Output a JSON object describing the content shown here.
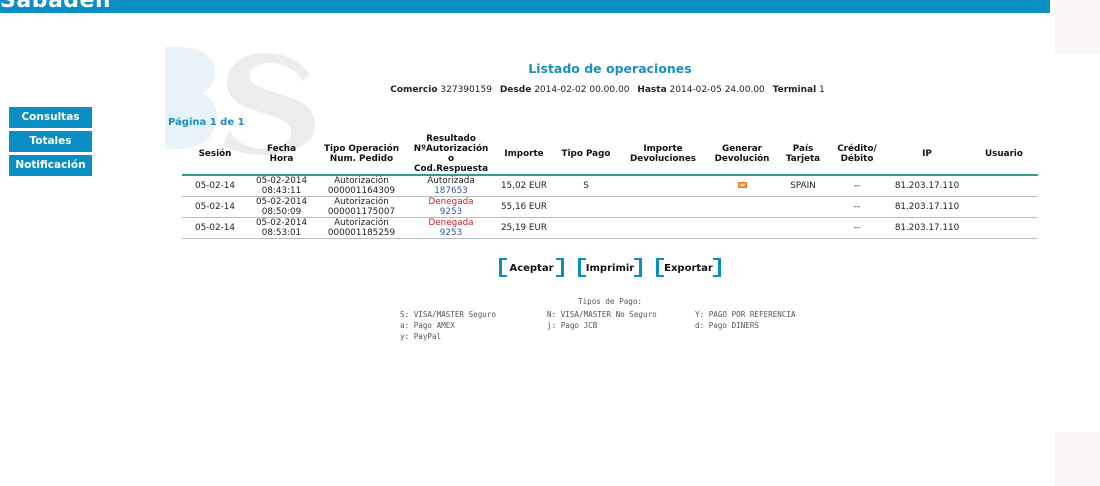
{
  "header": {
    "logo_text": "Sabadell",
    "accent_color": "#0a8fc4"
  },
  "sidebar": {
    "items": [
      {
        "label": "Consultas"
      },
      {
        "label": "Totales"
      },
      {
        "label": "Notificación"
      }
    ]
  },
  "page": {
    "title": "Listado de operaciones",
    "filters": {
      "comercio_label": "Comercio",
      "comercio_value": "327390159",
      "desde_label": "Desde",
      "desde_value": "2014-02-02  00.00.00",
      "hasta_label": "Hasta",
      "hasta_value": "2014-02-05  24.00.00",
      "terminal_label": "Terminal",
      "terminal_value": "1"
    },
    "pagination": "Página 1 de 1"
  },
  "table": {
    "headers": {
      "sesion": "Sesión",
      "fecha_l1": "Fecha",
      "fecha_l2": "Hora",
      "tipo_l1": "Tipo Operación",
      "tipo_l2": "Num. Pedido",
      "resultado_l1": "Resultado",
      "resultado_l2": "NºAutorización",
      "resultado_l3": "o Cod.Respuesta",
      "importe": "Importe",
      "tipo_pago": "Tipo Pago",
      "devol_l1": "Importe",
      "devol_l2": "Devoluciones",
      "generar_l1": "Generar",
      "generar_l2": "Devolución",
      "pais_l1": "País",
      "pais_l2": "Tarjeta",
      "credito_l1": "Crédito/",
      "credito_l2": "Débito",
      "ip": "IP",
      "usuario": "Usuario"
    },
    "rows": [
      {
        "sesion": "05-02-14",
        "fecha": "05-02-2014",
        "hora": "08:43:11",
        "tipo": "Autorización",
        "pedido": "000001164309",
        "resultado": "Autorizada",
        "codigo": "187653",
        "importe": "15,02 EUR",
        "tipo_pago": "S",
        "devoluciones": "",
        "pais": "SPAIN",
        "credito": "--",
        "ip": "81.203.17.110",
        "usuario": ""
      },
      {
        "sesion": "05-02-14",
        "fecha": "05-02-2014",
        "hora": "08:50:09",
        "tipo": "Autorización",
        "pedido": "000001175007",
        "resultado": "Denegada",
        "codigo": "9253",
        "importe": "55,16 EUR",
        "tipo_pago": "",
        "devoluciones": "",
        "pais": "",
        "credito": "--",
        "ip": "81.203.17.110",
        "usuario": ""
      },
      {
        "sesion": "05-02-14",
        "fecha": "05-02-2014",
        "hora": "08:53:01",
        "tipo": "Autorización",
        "pedido": "000001185259",
        "resultado": "Denegada",
        "codigo": "9253",
        "importe": "25,19 EUR",
        "tipo_pago": "",
        "devoluciones": "",
        "pais": "",
        "credito": "--",
        "ip": "81.203.17.110",
        "usuario": ""
      }
    ]
  },
  "buttons": {
    "aceptar": "Aceptar",
    "imprimir": "Imprimir",
    "exportar": "Exportar"
  },
  "legend": {
    "title": "Tipos de Pago:",
    "items": [
      "S: VISA/MASTER Seguro",
      "N: VISA/MASTER No Seguro",
      "Y: PAGO POR REFERENCIA",
      "a: Pago AMEX",
      "j: Pago JCB",
      "d: Pago DINERS",
      "y: PayPal"
    ]
  }
}
